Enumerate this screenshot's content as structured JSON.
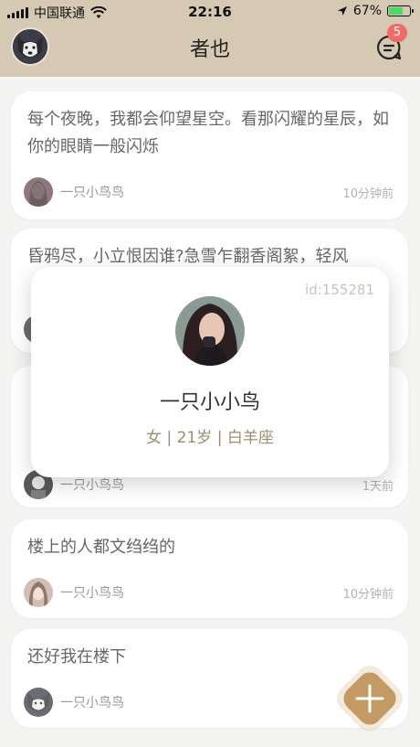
{
  "status_bar": {
    "carrier": "中国联通",
    "time": "22:16",
    "battery": "67%",
    "battery_level": 0.67
  },
  "header": {
    "title": "者也",
    "message_badge": "5"
  },
  "posts": [
    {
      "text": "每个夜晚，我都会仰望星空。看那闪耀的星辰，如你的眼睛一般闪烁",
      "author": "一只小鸟鸟",
      "time": "10分钟前"
    },
    {
      "text": "昏鸦尽，小立恨因谁?急雪乍翻香阁絮，轻风",
      "author": "",
      "time": ""
    },
    {
      "text": "",
      "author": "一只小鸟鸟",
      "time": "1天前"
    },
    {
      "text": "楼上的人都文绉绉的",
      "author": "一只小鸟鸟",
      "time": "10分钟前"
    },
    {
      "text": "还好我在楼下",
      "author": "一只小鸟鸟",
      "time": ""
    }
  ],
  "profile_popup": {
    "id": "id:155281",
    "name": "一只小小鸟",
    "meta": "女 | 21岁 | 白羊座"
  },
  "icons": {
    "wifi": "wifi-icon",
    "location": "location-arrow-icon",
    "battery": "battery-icon",
    "messages": "chat-bubble-icon",
    "add": "plus-icon"
  },
  "colors": {
    "header_bg": "#d6c9b4",
    "badge": "#f06b67",
    "fab": "#c49a64",
    "meta_text": "#a08a6e"
  }
}
